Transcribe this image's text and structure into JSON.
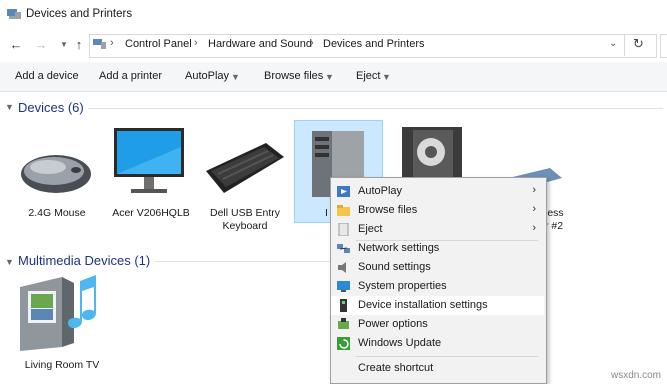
{
  "window": {
    "title": "Devices and Printers"
  },
  "breadcrumb": [
    "Control Panel",
    "Hardware and Sound",
    "Devices and Printers"
  ],
  "toolbar": {
    "add_device": "Add a device",
    "add_printer": "Add a printer",
    "autoplay": "AutoPlay",
    "browse_files": "Browse files",
    "eject": "Eject"
  },
  "groups": {
    "devices": {
      "title": "Devices (6)"
    },
    "multimedia": {
      "title": "Multimedia Devices (1)"
    }
  },
  "devices": [
    {
      "line1": "2.4G Mouse",
      "line2": ""
    },
    {
      "line1": "Acer V206HQLB",
      "line2": ""
    },
    {
      "line1": "Dell USB Entry",
      "line2": "Keyboard"
    },
    {
      "line1": "I",
      "line2": ""
    },
    {
      "line1": "less",
      "line2": "r #2"
    }
  ],
  "multimedia_devices": [
    {
      "line1": "Living Room TV"
    }
  ],
  "context_menu": {
    "autoplay": "AutoPlay",
    "browse_files": "Browse files",
    "eject": "Eject",
    "network_settings": "Network settings",
    "sound_settings": "Sound settings",
    "system_properties": "System properties",
    "device_installation_settings": "Device installation settings",
    "power_options": "Power options",
    "windows_update": "Windows Update",
    "create_shortcut": "Create shortcut"
  },
  "watermark": "wsxdn.com",
  "colors": {
    "group_title": "#1e3287",
    "selection": "#cce8ff",
    "menu_bg": "#f2f2f2"
  }
}
